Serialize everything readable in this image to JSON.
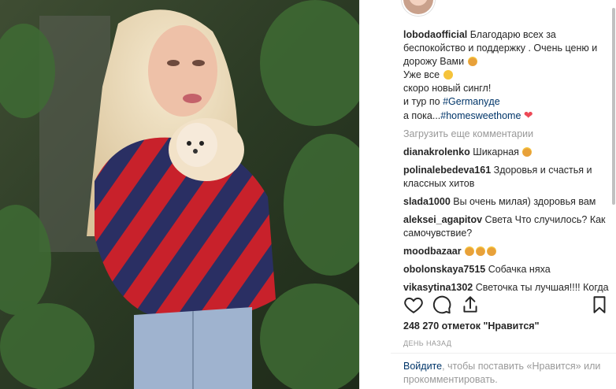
{
  "post": {
    "author": "lobodaofficial",
    "caption_lines": [
      "Благодарю всех за беспокойство и поддержку . Очень ценю и дорожу Вами",
      "Уже все",
      "скоро новый сингл!",
      "и тур по ",
      "а пока..."
    ],
    "caption_tag_germany": "#Germanyде",
    "caption_tag_home": "#homesweethome",
    "load_more": "Загрузить еще комментарии",
    "comments": [
      {
        "user": "dianakrolenko",
        "text": "Шикарная"
      },
      {
        "user": "polinalebedeva161",
        "text": "Здоровья и счастья и классных хитов"
      },
      {
        "user": "slada1000",
        "text": "Вы очень милая) здоровья вам"
      },
      {
        "user": "aleksei_agapitov",
        "text": "Света Что случилось? Как самочувствие?"
      },
      {
        "user": "moodbazaar",
        "text": ""
      },
      {
        "user": "obolonskaya7515",
        "text": "Собачка няха"
      },
      {
        "user": "vikasytina1302",
        "text": "Светочка ты лучшая!!!! Когда новая песня? просто мне так"
      }
    ],
    "likes": "248 270 отметок \"Нравится\"",
    "date": "ДЕНЬ НАЗАД",
    "login_link": "Войдите",
    "login_text": ", чтобы поставить «Нравится» или прокомментировать."
  },
  "icons": {
    "like": "heart-outline-icon",
    "comment": "comment-bubble-icon",
    "share": "share-icon",
    "save": "bookmark-icon"
  },
  "colors": {
    "link": "#003569",
    "muted": "#999999",
    "heart": "#ed4956"
  }
}
